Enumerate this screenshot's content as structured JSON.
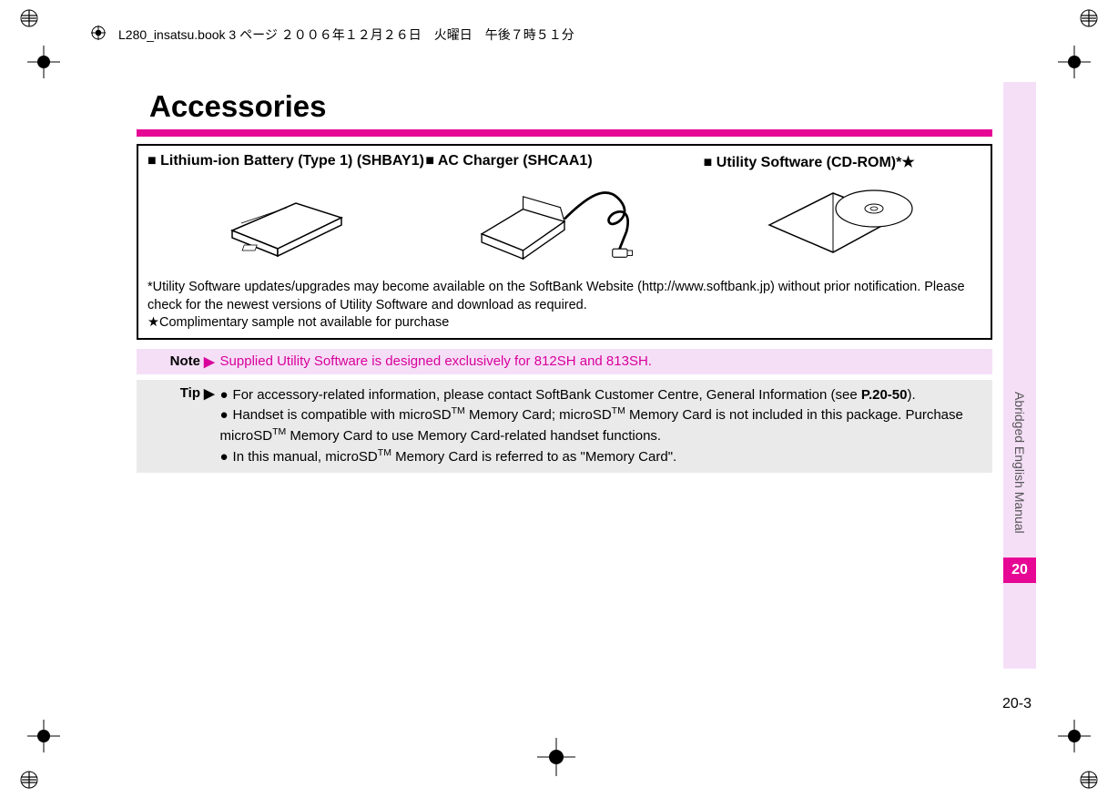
{
  "docHeader": {
    "text": "L280_insatsu.book  3 ページ  ２００６年１２月２６日　火曜日　午後７時５１分"
  },
  "page": {
    "headline": "Accessories",
    "accessories": [
      {
        "title": "■ Lithium-ion Battery (Type 1) (SHBAY1)"
      },
      {
        "title": "■ AC Charger (SHCAA1)"
      },
      {
        "title": "■ Utility Software (CD-ROM)*★"
      }
    ],
    "footnotes": {
      "line1": "*Utility Software updates/upgrades may become available on the SoftBank Website (http://www.softbank.jp) without prior notification. Please check for the newest versions of Utility Software and download as required.",
      "line2": "★Complimentary sample not available for purchase"
    },
    "note": {
      "label": "Note",
      "arrow": "▶",
      "text": "Supplied Utility Software is designed exclusively for 812SH and 813SH."
    },
    "tip": {
      "label": "Tip",
      "arrow": "▶",
      "items": [
        {
          "prefix": "●",
          "text_parts": [
            "For accessory-related information, please contact SoftBank Customer Centre, General Information (see ",
            "P.20-50",
            ")."
          ]
        },
        {
          "prefix": "●",
          "text_parts": [
            "Handset is compatible with microSD",
            "TM",
            " Memory Card; microSD",
            "TM",
            " Memory Card is not included in this package. Purchase microSD",
            "TM",
            " Memory Card to use Memory Card-related handset functions."
          ]
        },
        {
          "prefix": "●",
          "text_parts": [
            "In this manual, microSD",
            "TM",
            " Memory Card is referred to as \"Memory Card\"."
          ]
        }
      ]
    }
  },
  "sidebar": {
    "vertical_label": "Abridged English Manual",
    "chapter_number": "20",
    "page_number": "20-3"
  }
}
